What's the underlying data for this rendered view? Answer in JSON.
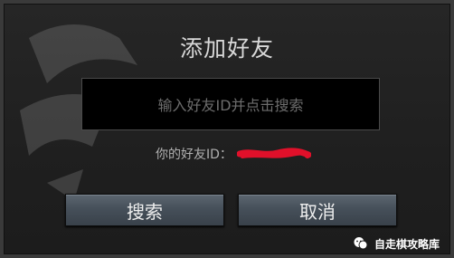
{
  "dialog": {
    "title": "添加好友",
    "input": {
      "placeholder": "输入好友ID并点击搜索"
    },
    "friend_id_label": "你的好友ID：",
    "buttons": {
      "search": "搜索",
      "cancel": "取消"
    }
  },
  "watermark_brand": "自走棋攻略库",
  "colors": {
    "redaction": "#e0102a",
    "button_top": "#5c6670",
    "button_bottom": "#39414a",
    "panel_bg": "#222222"
  },
  "icons": {
    "brand": "wechat-logo-icon"
  }
}
